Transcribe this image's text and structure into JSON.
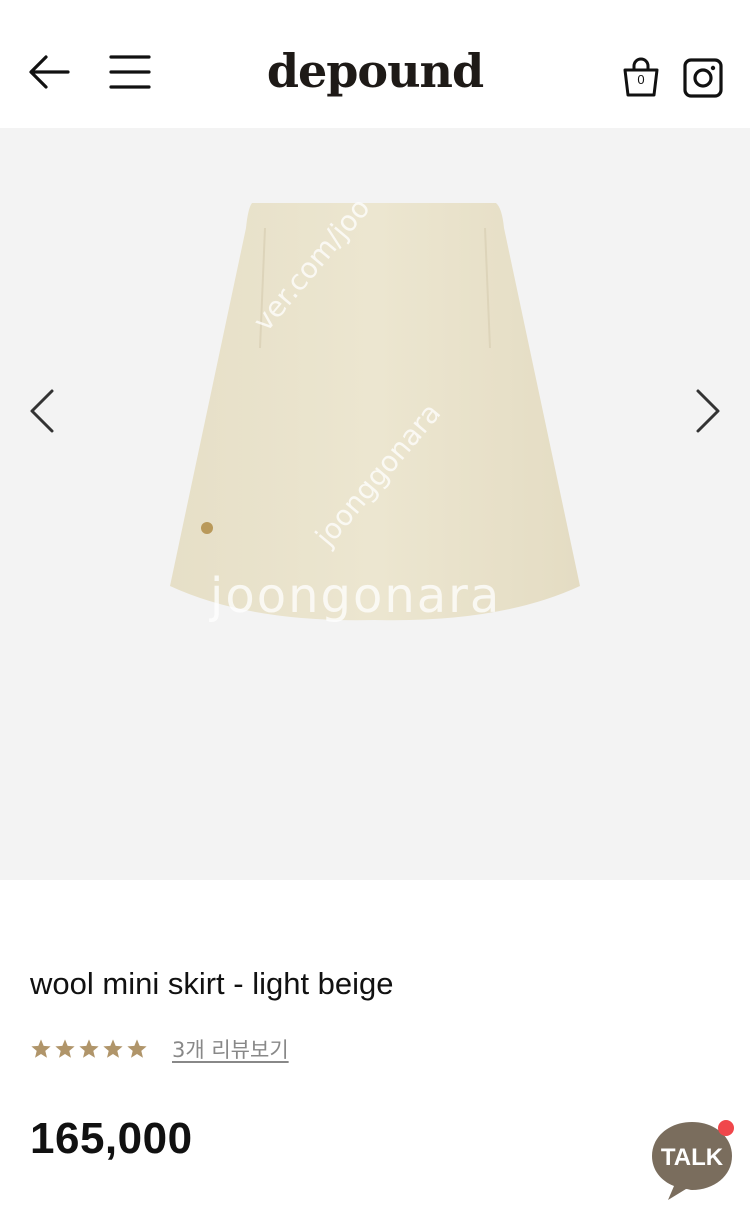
{
  "header": {
    "logo": "depound",
    "cart_count": "0"
  },
  "icons": {
    "back": "back-arrow-icon",
    "menu": "hamburger-menu-icon",
    "cart": "shopping-bag-icon",
    "instagram": "instagram-icon",
    "prev": "chevron-left-icon",
    "next": "chevron-right-icon",
    "talk": "kakao-talk-icon"
  },
  "gallery": {
    "watermark_main": "joongonara",
    "watermark_diag1": "joonggonara",
    "watermark_diag2": "ver.com/joo"
  },
  "product": {
    "title": "wool mini skirt - light beige",
    "rating": 5,
    "rating_max": 5,
    "review_link": "3개 리뷰보기",
    "price": "165,000"
  },
  "chat": {
    "label": "TALK"
  },
  "colors": {
    "star": "#b0956a",
    "skirt": "#e9e2cb",
    "talk_bubble": "#7a6d5d",
    "notification_dot": "#f0474b",
    "gallery_bg": "#f3f3f3"
  }
}
